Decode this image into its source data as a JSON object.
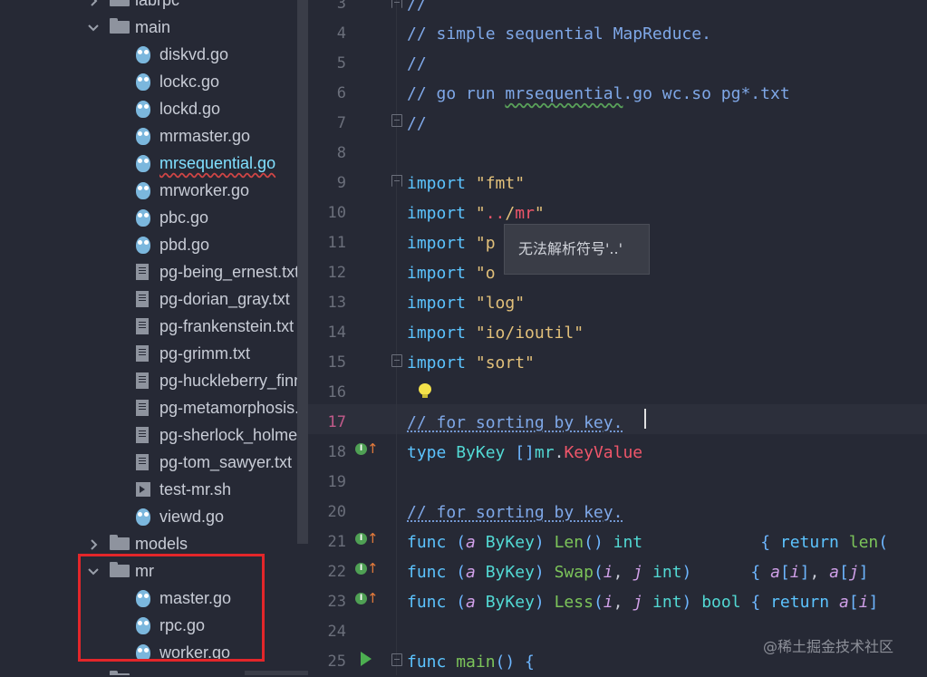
{
  "tree": {
    "items": [
      {
        "label": "labrpc",
        "kind": "folder",
        "indent": 1,
        "chevron": "right"
      },
      {
        "label": "main",
        "kind": "folder",
        "indent": 1,
        "chevron": "down"
      },
      {
        "label": "diskvd.go",
        "kind": "go",
        "indent": 2
      },
      {
        "label": "lockc.go",
        "kind": "go",
        "indent": 2
      },
      {
        "label": "lockd.go",
        "kind": "go",
        "indent": 2
      },
      {
        "label": "mrmaster.go",
        "kind": "go",
        "indent": 2
      },
      {
        "label": "mrsequential.go",
        "kind": "go",
        "indent": 2,
        "error": true
      },
      {
        "label": "mrworker.go",
        "kind": "go",
        "indent": 2
      },
      {
        "label": "pbc.go",
        "kind": "go",
        "indent": 2
      },
      {
        "label": "pbd.go",
        "kind": "go",
        "indent": 2
      },
      {
        "label": "pg-being_ernest.txt",
        "kind": "txt",
        "indent": 2
      },
      {
        "label": "pg-dorian_gray.txt",
        "kind": "txt",
        "indent": 2
      },
      {
        "label": "pg-frankenstein.txt",
        "kind": "txt",
        "indent": 2
      },
      {
        "label": "pg-grimm.txt",
        "kind": "txt",
        "indent": 2
      },
      {
        "label": "pg-huckleberry_finn.txt",
        "kind": "txt",
        "indent": 2
      },
      {
        "label": "pg-metamorphosis.txt",
        "kind": "txt",
        "indent": 2
      },
      {
        "label": "pg-sherlock_holmes.txt",
        "kind": "txt",
        "indent": 2
      },
      {
        "label": "pg-tom_sawyer.txt",
        "kind": "txt",
        "indent": 2
      },
      {
        "label": "test-mr.sh",
        "kind": "sh",
        "indent": 2
      },
      {
        "label": "viewd.go",
        "kind": "go",
        "indent": 2
      },
      {
        "label": "models",
        "kind": "folder",
        "indent": 1,
        "chevron": "right"
      },
      {
        "label": "mr",
        "kind": "folder",
        "indent": 1,
        "chevron": "down"
      },
      {
        "label": "master.go",
        "kind": "go",
        "indent": 2
      },
      {
        "label": "rpc.go",
        "kind": "go",
        "indent": 2
      },
      {
        "label": "worker.go",
        "kind": "go",
        "indent": 2
      },
      {
        "label": "mrapps",
        "kind": "folder",
        "indent": 1,
        "chevron": "right"
      }
    ]
  },
  "editor": {
    "current_line": "17",
    "lines": [
      {
        "n": "3",
        "html": [
          [
            "cm",
            "//"
          ]
        ]
      },
      {
        "n": "4",
        "html": [
          [
            "cm",
            "// simple sequential MapReduce."
          ]
        ]
      },
      {
        "n": "5",
        "html": [
          [
            "cm",
            "//"
          ]
        ]
      },
      {
        "n": "6",
        "html": [
          [
            "cm",
            "// go run "
          ],
          [
            "cm wavy",
            "mrsequential"
          ],
          [
            "cm",
            ".go wc.so pg*.txt"
          ]
        ]
      },
      {
        "n": "7",
        "html": [
          [
            "cm",
            "//"
          ]
        ]
      },
      {
        "n": "8",
        "html": []
      },
      {
        "n": "9",
        "html": [
          [
            "kw",
            "import "
          ],
          [
            "str",
            "\"fmt\""
          ]
        ]
      },
      {
        "n": "10",
        "html": [
          [
            "kw",
            "import "
          ],
          [
            "str",
            "\""
          ],
          [
            "red",
            ".."
          ],
          [
            "str",
            "/"
          ],
          [
            "red",
            "mr"
          ],
          [
            "str",
            "\""
          ]
        ]
      },
      {
        "n": "11",
        "html": [
          [
            "kw",
            "import "
          ],
          [
            "str",
            "\"p"
          ]
        ]
      },
      {
        "n": "12",
        "html": [
          [
            "kw",
            "import "
          ],
          [
            "str",
            "\"o"
          ]
        ]
      },
      {
        "n": "13",
        "html": [
          [
            "kw",
            "import "
          ],
          [
            "str",
            "\"log\""
          ]
        ]
      },
      {
        "n": "14",
        "html": [
          [
            "kw",
            "import "
          ],
          [
            "str",
            "\"io/ioutil\""
          ]
        ]
      },
      {
        "n": "15",
        "html": [
          [
            "kw",
            "import "
          ],
          [
            "str",
            "\"sort\""
          ]
        ]
      },
      {
        "n": "16",
        "html": []
      },
      {
        "n": "17",
        "html": [
          [
            "cm-u",
            "// for sorting by key."
          ]
        ]
      },
      {
        "n": "18",
        "html": [
          [
            "kw",
            "type "
          ],
          [
            "ty",
            "ByKey "
          ],
          [
            "punc",
            "[]"
          ],
          [
            "ty",
            "mr"
          ],
          [
            "",
            "."
          ],
          [
            "red",
            "KeyValue"
          ]
        ]
      },
      {
        "n": "19",
        "html": []
      },
      {
        "n": "20",
        "html": [
          [
            "cm-u",
            "// for sorting by key."
          ]
        ]
      },
      {
        "n": "21",
        "html": [
          [
            "kw",
            "func "
          ],
          [
            "punc",
            "("
          ],
          [
            "param",
            "a "
          ],
          [
            "ty",
            "ByKey"
          ],
          [
            "punc",
            ")"
          ],
          [
            "fn",
            " Len"
          ],
          [
            "punc",
            "() "
          ],
          [
            "ty",
            "int"
          ],
          [
            "",
            "            "
          ],
          [
            "punc",
            "{ "
          ],
          [
            "kw",
            "return "
          ],
          [
            "fn",
            "len"
          ],
          [
            "punc",
            "("
          ]
        ]
      },
      {
        "n": "22",
        "html": [
          [
            "kw",
            "func "
          ],
          [
            "punc",
            "("
          ],
          [
            "param",
            "a "
          ],
          [
            "ty",
            "ByKey"
          ],
          [
            "punc",
            ")"
          ],
          [
            "fn",
            " Swap"
          ],
          [
            "punc",
            "("
          ],
          [
            "param",
            "i"
          ],
          [
            "",
            ", "
          ],
          [
            "param",
            "j "
          ],
          [
            "ty",
            "int"
          ],
          [
            "punc",
            ")"
          ],
          [
            "",
            "      "
          ],
          [
            "punc",
            "{ "
          ],
          [
            "param",
            "a"
          ],
          [
            "punc",
            "["
          ],
          [
            "param",
            "i"
          ],
          [
            "punc",
            "]"
          ],
          [
            "",
            ", "
          ],
          [
            "param",
            "a"
          ],
          [
            "punc",
            "["
          ],
          [
            "param",
            "j"
          ],
          [
            "punc",
            "]"
          ]
        ]
      },
      {
        "n": "23",
        "html": [
          [
            "kw",
            "func "
          ],
          [
            "punc",
            "("
          ],
          [
            "param",
            "a "
          ],
          [
            "ty",
            "ByKey"
          ],
          [
            "punc",
            ")"
          ],
          [
            "fn",
            " Less"
          ],
          [
            "punc",
            "("
          ],
          [
            "param",
            "i"
          ],
          [
            "",
            ", "
          ],
          [
            "param",
            "j "
          ],
          [
            "ty",
            "int"
          ],
          [
            "punc",
            ") "
          ],
          [
            "ty",
            "bool "
          ],
          [
            "punc",
            "{ "
          ],
          [
            "kw",
            "return "
          ],
          [
            "param",
            "a"
          ],
          [
            "punc",
            "["
          ],
          [
            "param",
            "i"
          ],
          [
            "punc",
            "]"
          ]
        ]
      },
      {
        "n": "24",
        "html": []
      },
      {
        "n": "25",
        "html": [
          [
            "kw",
            "func "
          ],
          [
            "fn",
            "main"
          ],
          [
            "punc",
            "() {"
          ]
        ]
      }
    ]
  },
  "tooltip": {
    "text": "无法解析符号'..'"
  },
  "watermark": {
    "text": "@稀土掘金技术社区"
  }
}
